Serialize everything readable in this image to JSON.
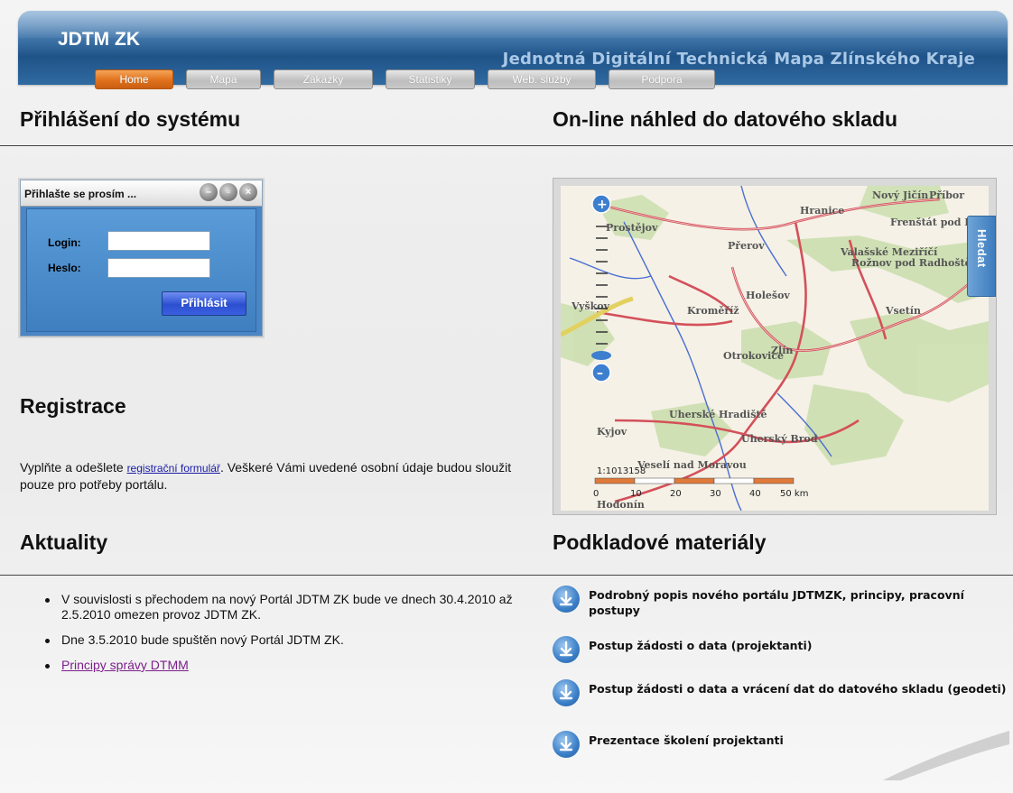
{
  "header": {
    "brand": "JDTM ZK",
    "tagline": "Jednotná Digitální Technická Mapa Zlínského Kraje"
  },
  "nav": {
    "tabs": [
      {
        "label": "Home",
        "active": true
      },
      {
        "label": "Mapa",
        "active": false
      },
      {
        "label": "Zakázky",
        "active": false
      },
      {
        "label": "Statistiky",
        "active": false
      },
      {
        "label": "Web. služby",
        "active": false
      },
      {
        "label": "Podpora",
        "active": false
      }
    ]
  },
  "login": {
    "heading": "Přihlášení do systému",
    "dialog_title": "Přihlašte se prosím ...",
    "login_label": "Login:",
    "login_value": "",
    "password_label": "Heslo:",
    "password_value": "",
    "submit": "Přihlásit"
  },
  "registration": {
    "heading": "Registrace",
    "text_before": "Vyplňte a odešlete ",
    "link": "registrační formulář",
    "text_after": ". Veškeré Vámi uvedené osobní údaje budou sloužit pouze pro potřeby portálu."
  },
  "news": {
    "heading": "Aktuality",
    "items": [
      "V souvislosti s přechodem na nový Portál JDTM ZK bude ve dnech 30.4.2010 až 2.5.2010 omezen provoz JDTM ZK.",
      "Dne 3.5.2010 bude spuštěn nový Portál JDTM ZK.",
      "Principy správy DTMM"
    ]
  },
  "map": {
    "heading": "On-line náhled do datového skladu",
    "search_tab": "Hledat",
    "scale_text": "1:1013158",
    "scale_ticks": [
      "0",
      "10",
      "20",
      "30",
      "40",
      "50 km"
    ],
    "places": [
      "Nový Jičín",
      "Příbor",
      "Hranice",
      "Frenštát pod Radhoštěm",
      "Prostějov",
      "Přerov",
      "Valašské Meziříčí",
      "Rožnov pod Radhoštěm",
      "Holešov",
      "Kroměříž",
      "Vsetín",
      "Vyškov",
      "Otrokovice",
      "Zlín",
      "Uherské Hradiště",
      "Kyjov",
      "Uherský Brod",
      "Veselí nad Moravou",
      "Hodonín"
    ]
  },
  "materials": {
    "heading": "Podkladové materiály",
    "items": [
      "Podrobný popis nového portálu JDTMZK, principy, pracovní postupy",
      "Postup žádosti o data (projektanti)",
      "Postup žádosti o data a vrácení dat do datového skladu (geodeti)",
      "Prezentace školení projektanti"
    ]
  },
  "colors": {
    "header_blue": "#2f6aa1",
    "active_tab": "#e0711c",
    "link": "#1a1aa8",
    "visited_link": "#7b1f8a"
  }
}
